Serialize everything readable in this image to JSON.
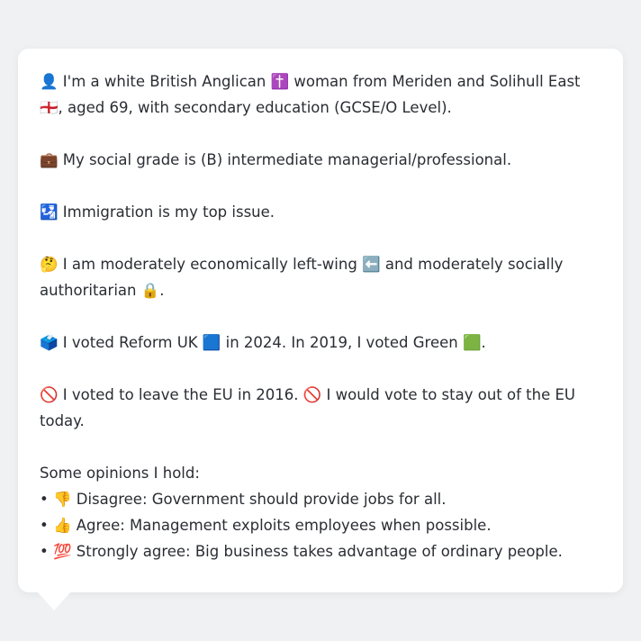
{
  "profile": {
    "line1": "👤 I'm a white British Anglican ✝️ woman from Meriden and Solihull East 🏴󠁧󠁢󠁥󠁮󠁧󠁿, aged 69, with secondary education (GCSE/O Level).",
    "grade": "💼 My social grade is (B) intermediate managerial/professional.",
    "issue": "🛂 Immigration is my top issue.",
    "ideology": "🤔 I am moderately economically left-wing ⬅️ and moderately socially authoritarian 🔒.",
    "votes": "🗳️ I voted Reform UK 🟦 in 2024. In 2019, I voted Green 🟩.",
    "eu": "🚫 I voted to leave the EU in 2016. 🚫 I would vote to stay out of the EU today.",
    "opinions_heading": "Some opinions I hold:",
    "opinions": [
      "• 👎 Disagree: Government should provide jobs for all.",
      "• 👍 Agree: Management exploits employees when possible.",
      "• 💯 Strongly agree: Big business takes advantage of ordinary people."
    ]
  }
}
